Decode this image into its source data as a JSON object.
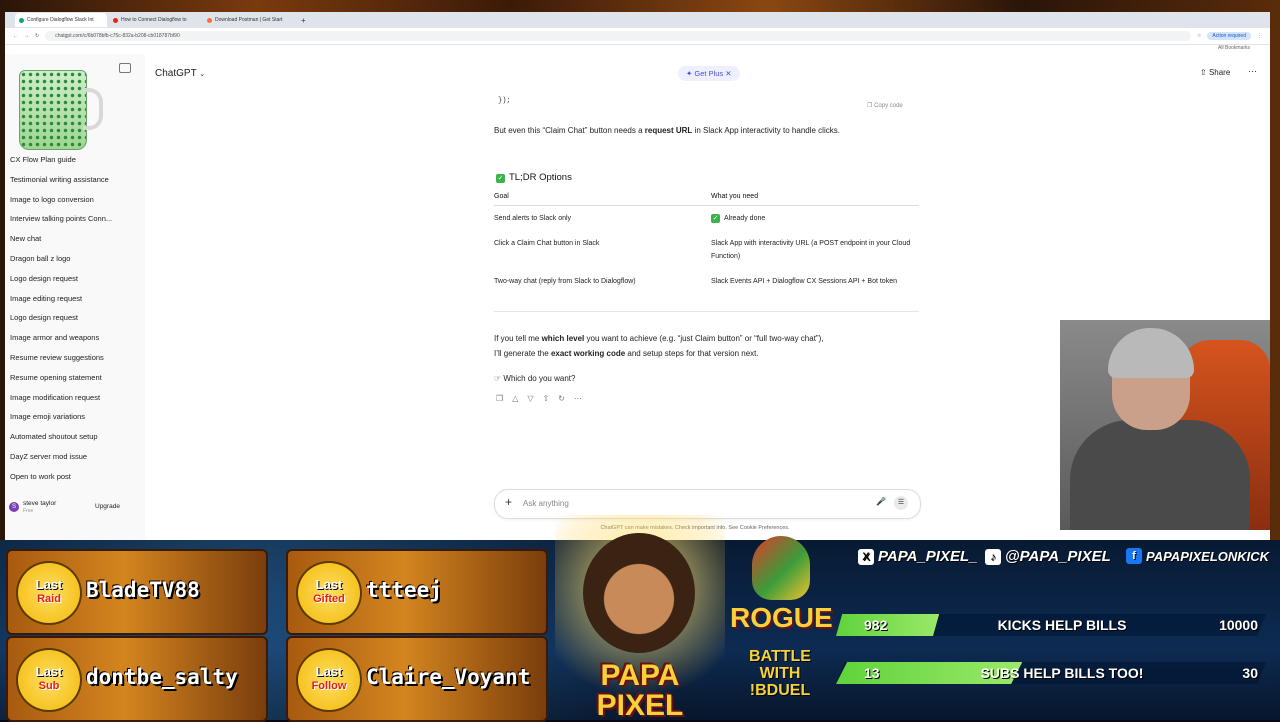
{
  "browser": {
    "tabs": [
      {
        "label": "Configure Dialogflow Slack Int",
        "color": "#10a37f"
      },
      {
        "label": "How to Connect Dialogflow to",
        "color": "#e62117"
      },
      {
        "label": "Download Postman | Get Start",
        "color": "#ff6c37"
      }
    ],
    "url": "chatgpt.com/c/6b078bfb-c75c-832a-b208-cb018787bf90",
    "bookmarks": "All Bookmarks",
    "update_badge": "Action required"
  },
  "sidebar": {
    "items": [
      "CX Flow Plan guide",
      "Testimonial writing assistance",
      "Image to logo conversion",
      "Interview talking points Conn...",
      "New chat",
      "Dragon ball z logo",
      "Logo design request",
      "Image editing request",
      "Logo design request",
      "Image armor and weapons",
      "Resume review suggestions",
      "Resume opening statement",
      "Image modification request",
      "Image emoji variations",
      "Automated shoutout setup",
      "DayZ server mod issue",
      "Open to work post"
    ],
    "user_name": "steve taylor",
    "user_plan": "Free",
    "user_initial": "S",
    "upgrade_label": "Upgrade"
  },
  "header": {
    "model": "ChatGPT",
    "get_plus": "Get Plus",
    "share": "Share"
  },
  "message": {
    "code_tail": "});",
    "copy_code": "Copy code",
    "claim_text_1": "But even this “Claim Chat” button needs a ",
    "claim_bold": "request URL",
    "claim_text_2": " in Slack App interactivity to handle clicks.",
    "tldr_title": "TL;DR Options",
    "table": {
      "col_goal": "Goal",
      "col_need": "What you need",
      "rows": [
        {
          "goal": "Send alerts to Slack only",
          "need": "Already done"
        },
        {
          "goal": "Click a Claim Chat button in Slack",
          "need": "Slack App with interactivity URL (a POST endpoint in your Cloud Function)"
        },
        {
          "goal": "Two-way chat (reply from Slack to Dialogflow)",
          "need": "Slack Events API + Dialogflow CX Sessions API + Bot token"
        }
      ]
    },
    "p1_a": "If you tell me ",
    "p1_bold": "which level",
    "p1_b": " you want to achieve (e.g. “just Claim button” or “full two-way chat”),",
    "p2_a": "I’ll generate the ",
    "p2_bold": "exact working code",
    "p2_b": " and setup steps for that version next.",
    "question": "Which do you want?"
  },
  "composer": {
    "placeholder": "Ask anything",
    "disclaimer": "ChatGPT can make mistakes. Check important info. See Cookie Preferences."
  },
  "overlay": {
    "cards": [
      {
        "top": "Last",
        "bottom": "Raid",
        "name": "BladeTV88"
      },
      {
        "top": "Last",
        "bottom": "Gifted",
        "name": "ttteej"
      },
      {
        "top": "Last",
        "bottom": "Sub",
        "name": "dontbe_salty"
      },
      {
        "top": "Last",
        "bottom": "Follow",
        "name": "Claire_Voyant"
      }
    ],
    "logo_text": "PAPA PIXEL",
    "rogue": "ROGUE",
    "battle": [
      "BATTLE",
      "WITH",
      "!BDUEL"
    ],
    "socials": [
      {
        "icon": "X",
        "handle": "PAPA_PIXEL_"
      },
      {
        "icon": "♪",
        "handle": "@PAPA_PIXEL"
      },
      {
        "icon": "f",
        "handle": "PAPAPIXELONKICK"
      }
    ],
    "goals": [
      {
        "current": "982",
        "label": "KICKS HELP BILLS",
        "max": "10000",
        "progress": 0.0982
      },
      {
        "current": "13",
        "label": "SUBS HELP BILLS TOO!",
        "max": "30",
        "progress": 0.4333
      }
    ]
  }
}
